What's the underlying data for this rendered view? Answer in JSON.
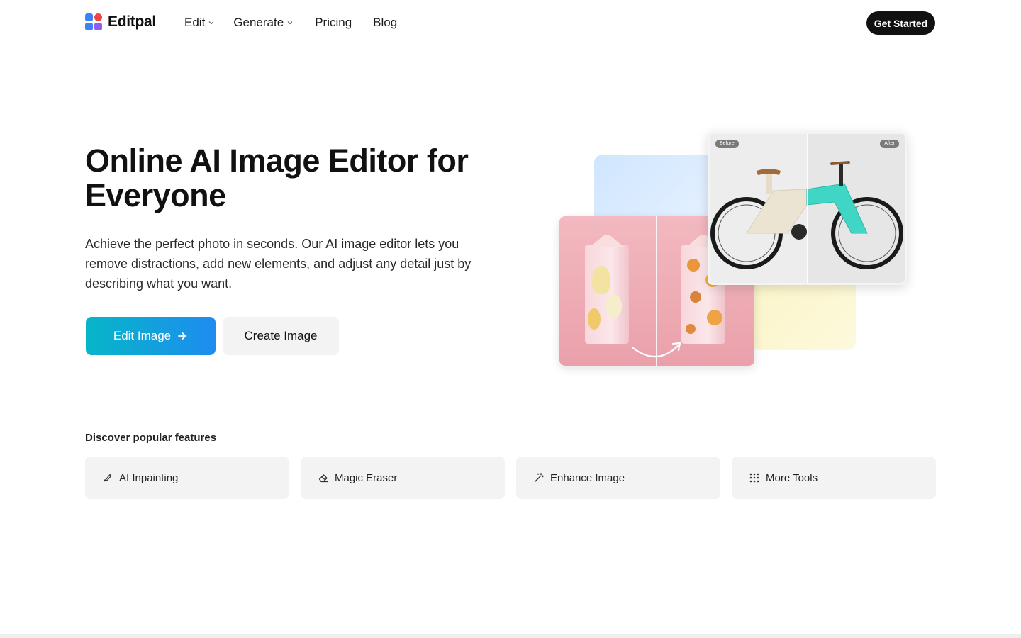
{
  "brand": {
    "name": "Editpal"
  },
  "nav": {
    "items": [
      {
        "label": "Edit",
        "has_dropdown": true
      },
      {
        "label": "Generate",
        "has_dropdown": true
      },
      {
        "label": "Pricing",
        "has_dropdown": false
      },
      {
        "label": "Blog",
        "has_dropdown": false
      }
    ],
    "cta_label": "Get Started"
  },
  "hero": {
    "title": "Online AI Image Editor for Everyone",
    "subtitle": "Achieve the perfect photo in seconds. Our AI image editor lets you remove distractions, add new elements, and adjust any detail just by describing what you want.",
    "primary_button": "Edit Image",
    "secondary_button": "Create Image",
    "compare_tags": {
      "before": "Before",
      "after": "After"
    }
  },
  "features": {
    "heading": "Discover popular features",
    "items": [
      {
        "label": "AI Inpainting",
        "icon": "brush-icon"
      },
      {
        "label": "Magic Eraser",
        "icon": "eraser-icon"
      },
      {
        "label": "Enhance Image",
        "icon": "magic-wand-icon"
      },
      {
        "label": "More Tools",
        "icon": "grid-dots-icon"
      }
    ]
  },
  "colors": {
    "primary_gradient_start": "#06b6c8",
    "primary_gradient_end": "#1e8cf0",
    "cta_dark": "#111111",
    "card_bg": "#f3f3f3"
  }
}
